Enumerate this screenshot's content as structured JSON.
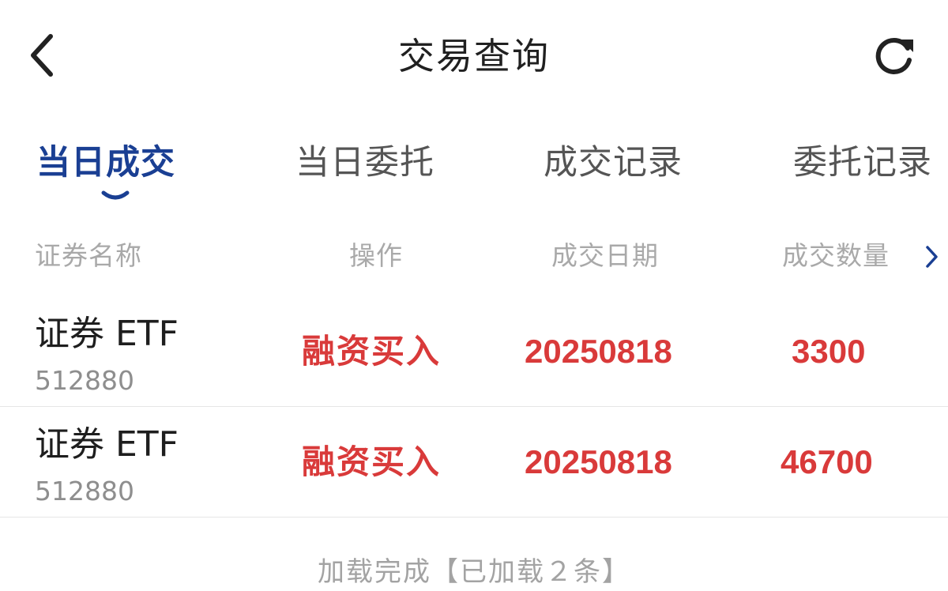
{
  "header": {
    "title": "交易查询",
    "back_icon": "chevron-left-icon",
    "refresh_icon": "refresh-icon"
  },
  "tabs": [
    {
      "label": "当日成交",
      "active": true
    },
    {
      "label": "当日委托",
      "active": false
    },
    {
      "label": "成交记录",
      "active": false
    },
    {
      "label": "委托记录",
      "active": false
    }
  ],
  "table": {
    "headers": [
      "证券名称",
      "操作",
      "成交日期",
      "成交数量"
    ],
    "more_icon": "chevron-right-icon",
    "rows": [
      {
        "name": "证券 ETF",
        "code": "512880",
        "operation": "融资买入",
        "date": "20250818",
        "quantity": "3300"
      },
      {
        "name": "证券 ETF",
        "code": "512880",
        "operation": "融资买入",
        "date": "20250818",
        "quantity": "46700"
      }
    ]
  },
  "footer": {
    "status": "加载完成【已加载２条】"
  },
  "colors": {
    "accent": "#1a3f93",
    "buy_red": "#d93a3a",
    "muted": "#a9a9a9"
  }
}
